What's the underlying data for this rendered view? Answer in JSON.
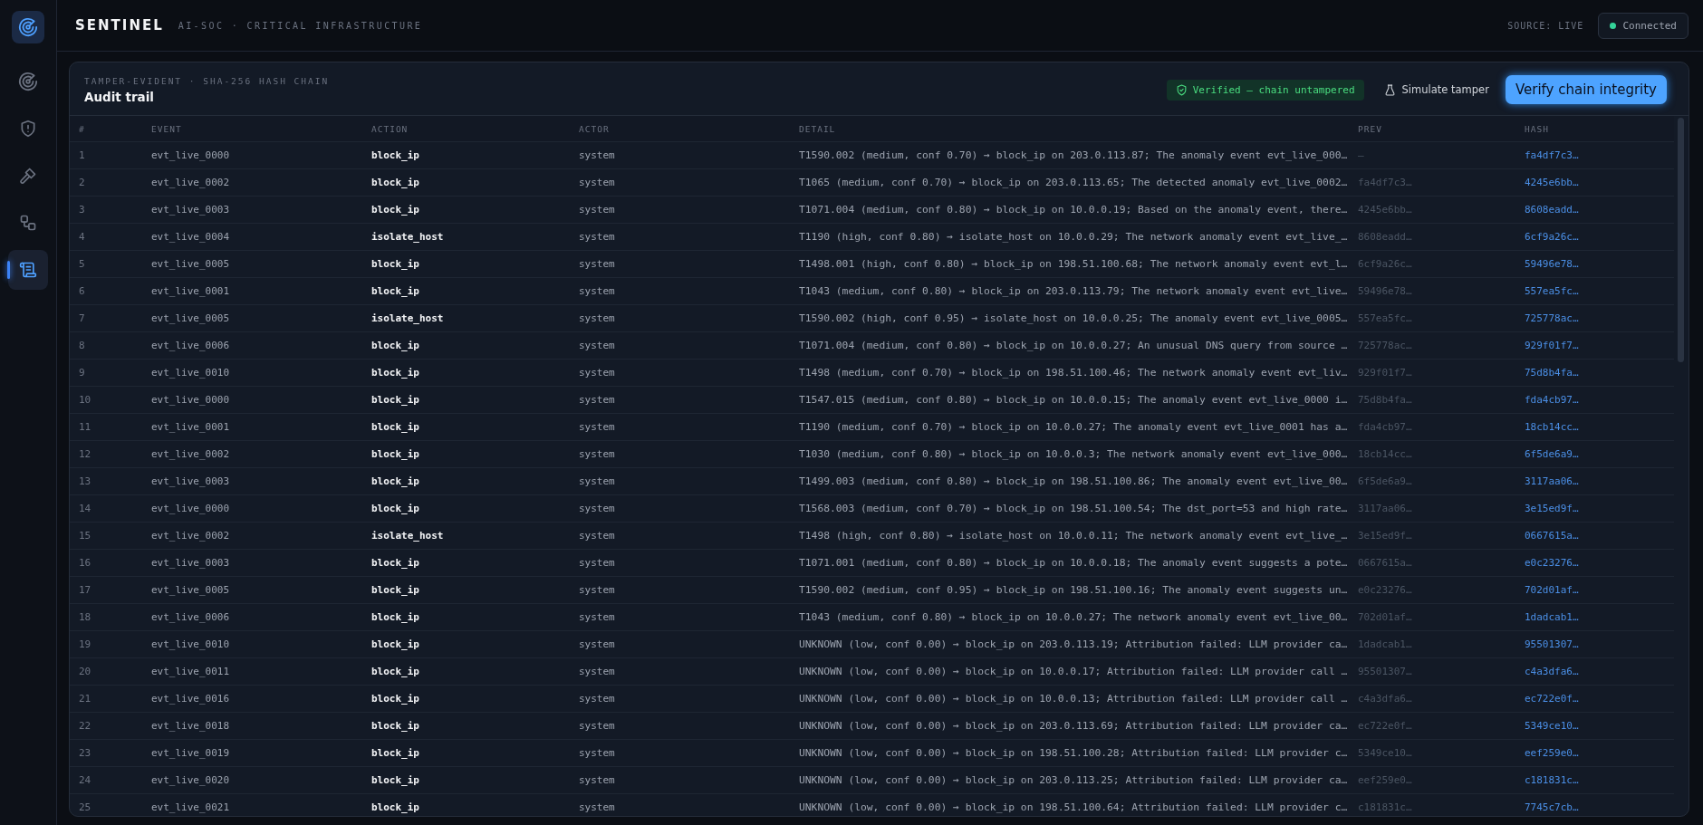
{
  "sidebar": {
    "items": [
      {
        "selected": false
      },
      {
        "selected": false
      },
      {
        "selected": false
      },
      {
        "selected": false
      },
      {
        "selected": true
      }
    ]
  },
  "header": {
    "brand": "SENTINEL",
    "subtitle": "AI-SOC · CRITICAL INFRASTRUCTURE",
    "source": "SOURCE: LIVE",
    "connection": {
      "label": "Connected",
      "color": "#34d399"
    }
  },
  "panel": {
    "eyebrow": "TAMPER-EVIDENT · SHA-256 HASH CHAIN",
    "title": "Audit trail",
    "status_badge": "Verified — chain untampered",
    "buttons": [
      {
        "label": "Simulate tamper",
        "kind": "ghost"
      },
      {
        "label": "Verify chain integrity",
        "kind": "primary"
      }
    ]
  },
  "table": {
    "columns": [
      "#",
      "EVENT",
      "ACTION",
      "ACTOR",
      "DETAIL",
      "PREV",
      "HASH"
    ],
    "rows": [
      [
        "1",
        "evt_live_0000",
        "block_ip",
        "system",
        "T1590.002 (medium, conf 0.70) → block_ip on 203.0.113.87; The anomaly event evt_live_000…",
        "—",
        "fa4df7c3…"
      ],
      [
        "2",
        "evt_live_0002",
        "block_ip",
        "system",
        "T1065 (medium, conf 0.70) → block_ip on 203.0.113.65; The detected anomaly evt_live_0002…",
        "fa4df7c3…",
        "4245e6bb…"
      ],
      [
        "3",
        "evt_live_0003",
        "block_ip",
        "system",
        "T1071.004 (medium, conf 0.80) → block_ip on 10.0.0.19; Based on the anomaly event, there…",
        "4245e6bb…",
        "8608eadd…"
      ],
      [
        "4",
        "evt_live_0004",
        "isolate_host",
        "system",
        "T1190 (high, conf 0.80) → isolate_host on 10.0.0.29; The network anomaly event evt_live_…",
        "8608eadd…",
        "6cf9a26c…"
      ],
      [
        "5",
        "evt_live_0005",
        "block_ip",
        "system",
        "T1498.001 (high, conf 0.80) → block_ip on 198.51.100.68; The network anomaly event evt_l…",
        "6cf9a26c…",
        "59496e78…"
      ],
      [
        "6",
        "evt_live_0001",
        "block_ip",
        "system",
        "T1043 (medium, conf 0.80) → block_ip on 203.0.113.79; The network anomaly event evt_live…",
        "59496e78…",
        "557ea5fc…"
      ],
      [
        "7",
        "evt_live_0005",
        "isolate_host",
        "system",
        "T1590.002 (high, conf 0.95) → isolate_host on 10.0.0.25; The anomaly event evt_live_0005…",
        "557ea5fc…",
        "725778ac…"
      ],
      [
        "8",
        "evt_live_0006",
        "block_ip",
        "system",
        "T1071.004 (medium, conf 0.80) → block_ip on 10.0.0.27; An unusual DNS query from source …",
        "725778ac…",
        "929f01f7…"
      ],
      [
        "9",
        "evt_live_0010",
        "block_ip",
        "system",
        "T1498 (medium, conf 0.70) → block_ip on 198.51.100.46; The network anomaly event evt_liv…",
        "929f01f7…",
        "75d8b4fa…"
      ],
      [
        "10",
        "evt_live_0000",
        "block_ip",
        "system",
        "T1547.015 (medium, conf 0.80) → block_ip on 10.0.0.15; The anomaly event evt_live_0000 i…",
        "75d8b4fa…",
        "fda4cb97…"
      ],
      [
        "11",
        "evt_live_0001",
        "block_ip",
        "system",
        "T1190 (medium, conf 0.70) → block_ip on 10.0.0.27; The anomaly event evt_live_0001 has a…",
        "fda4cb97…",
        "18cb14cc…"
      ],
      [
        "12",
        "evt_live_0002",
        "block_ip",
        "system",
        "T1030 (medium, conf 0.80) → block_ip on 10.0.0.3; The network anomaly event evt_live_000…",
        "18cb14cc…",
        "6f5de6a9…"
      ],
      [
        "13",
        "evt_live_0003",
        "block_ip",
        "system",
        "T1499.003 (medium, conf 0.80) → block_ip on 198.51.100.86; The anomaly event evt_live_00…",
        "6f5de6a9…",
        "3117aa06…"
      ],
      [
        "14",
        "evt_live_0000",
        "block_ip",
        "system",
        "T1568.003 (medium, conf 0.70) → block_ip on 198.51.100.54; The dst_port=53 and high rate…",
        "3117aa06…",
        "3e15ed9f…"
      ],
      [
        "15",
        "evt_live_0002",
        "isolate_host",
        "system",
        "T1498 (high, conf 0.80) → isolate_host on 10.0.0.11; The network anomaly event evt_live_…",
        "3e15ed9f…",
        "0667615a…"
      ],
      [
        "16",
        "evt_live_0003",
        "block_ip",
        "system",
        "T1071.001 (medium, conf 0.80) → block_ip on 10.0.0.18; The anomaly event suggests a pote…",
        "0667615a…",
        "e0c23276…"
      ],
      [
        "17",
        "evt_live_0005",
        "block_ip",
        "system",
        "T1590.002 (medium, conf 0.95) → block_ip on 198.51.100.16; The anomaly event suggests un…",
        "e0c23276…",
        "702d01af…"
      ],
      [
        "18",
        "evt_live_0006",
        "block_ip",
        "system",
        "T1043 (medium, conf 0.80) → block_ip on 10.0.0.27; The network anomaly event evt_live_00…",
        "702d01af…",
        "1dadcab1…"
      ],
      [
        "19",
        "evt_live_0010",
        "block_ip",
        "system",
        "UNKNOWN (low, conf 0.00) → block_ip on 203.0.113.19; Attribution failed: LLM provider ca…",
        "1dadcab1…",
        "95501307…"
      ],
      [
        "20",
        "evt_live_0011",
        "block_ip",
        "system",
        "UNKNOWN (low, conf 0.00) → block_ip on 10.0.0.17; Attribution failed: LLM provider call …",
        "95501307…",
        "c4a3dfa6…"
      ],
      [
        "21",
        "evt_live_0016",
        "block_ip",
        "system",
        "UNKNOWN (low, conf 0.00) → block_ip on 10.0.0.13; Attribution failed: LLM provider call …",
        "c4a3dfa6…",
        "ec722e0f…"
      ],
      [
        "22",
        "evt_live_0018",
        "block_ip",
        "system",
        "UNKNOWN (low, conf 0.00) → block_ip on 203.0.113.69; Attribution failed: LLM provider ca…",
        "ec722e0f…",
        "5349ce10…"
      ],
      [
        "23",
        "evt_live_0019",
        "block_ip",
        "system",
        "UNKNOWN (low, conf 0.00) → block_ip on 198.51.100.28; Attribution failed: LLM provider c…",
        "5349ce10…",
        "eef259e0…"
      ],
      [
        "24",
        "evt_live_0020",
        "block_ip",
        "system",
        "UNKNOWN (low, conf 0.00) → block_ip on 203.0.113.25; Attribution failed: LLM provider ca…",
        "eef259e0…",
        "c181831c…"
      ],
      [
        "25",
        "evt_live_0021",
        "block_ip",
        "system",
        "UNKNOWN (low, conf 0.00) → block_ip on 198.51.100.64; Attribution failed: LLM provider c…",
        "c181831c…",
        "7745c7cb…"
      ]
    ]
  }
}
